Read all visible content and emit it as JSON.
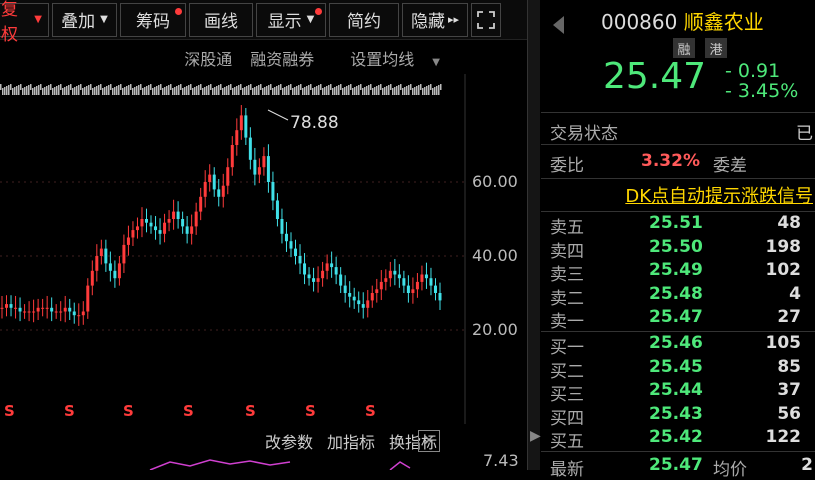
{
  "toolbar": {
    "items": [
      {
        "label": "复权",
        "active": true,
        "caret": true,
        "dot": false
      },
      {
        "label": "叠加",
        "caret": true,
        "dot": false
      },
      {
        "label": "筹码",
        "dot": true
      },
      {
        "label": "画线"
      },
      {
        "label": "显示",
        "caret": true,
        "dot": true
      },
      {
        "label": "简约"
      },
      {
        "label": "隐藏",
        "arrow": "▸▸"
      }
    ]
  },
  "subbar": {
    "items": [
      "深股通",
      "融资融券",
      "设置均线"
    ]
  },
  "chart": {
    "high_label": "78.88",
    "y_ticks": [
      "60.00",
      "40.00",
      "20.00"
    ],
    "bottom_tick": "7.43",
    "dividend_marker": "S"
  },
  "chart_data": {
    "type": "candlestick",
    "title": "",
    "annotations": [
      "78.88"
    ],
    "ylim": [
      12,
      88
    ],
    "y_ticks": [
      60,
      40,
      20
    ],
    "series": [
      {
        "values": [
          26,
          27,
          26,
          26,
          25,
          25,
          25,
          25,
          26,
          26,
          26,
          25,
          25,
          25,
          26,
          25,
          24,
          24,
          25,
          32,
          36,
          40,
          42,
          38,
          36,
          34,
          38,
          43,
          45,
          47,
          48,
          50,
          49,
          48,
          47,
          46,
          49,
          50,
          52,
          50,
          48,
          46,
          48,
          52,
          56,
          60,
          62,
          58,
          56,
          59,
          64,
          70,
          74,
          78,
          72,
          66,
          62,
          64,
          67,
          60,
          55,
          50,
          46,
          44,
          42,
          40,
          38,
          35,
          34,
          33,
          34,
          36,
          38,
          37,
          35,
          32,
          30,
          29,
          28,
          27,
          26,
          28,
          30,
          31,
          33,
          34,
          36,
          35,
          34,
          32,
          30,
          31,
          33,
          35,
          34,
          32,
          30,
          28
        ]
      }
    ]
  },
  "bottombar": {
    "items": [
      "改参数",
      "加指标",
      "换指标"
    ],
    "close": "✕"
  },
  "quote": {
    "code": "000860",
    "name": "顺鑫农业",
    "tags": [
      "融",
      "港"
    ],
    "price": "25.47",
    "change": "- 0.91",
    "change_pct": "- 3.45%"
  },
  "status": {
    "label": "交易状态",
    "value": "已"
  },
  "weibi": {
    "label": "委比",
    "value": "3.32%",
    "label2": "委差"
  },
  "dk_link": "DK点自动提示涨跌信号",
  "sell": [
    {
      "name": "卖五",
      "price": "25.51",
      "qty": "48"
    },
    {
      "name": "卖四",
      "price": "25.50",
      "qty": "198"
    },
    {
      "name": "卖三",
      "price": "25.49",
      "qty": "102"
    },
    {
      "name": "卖二",
      "price": "25.48",
      "qty": "4"
    },
    {
      "name": "卖一",
      "price": "25.47",
      "qty": "27"
    }
  ],
  "buy": [
    {
      "name": "买一",
      "price": "25.46",
      "qty": "105"
    },
    {
      "name": "买二",
      "price": "25.45",
      "qty": "85"
    },
    {
      "name": "买三",
      "price": "25.44",
      "qty": "37"
    },
    {
      "name": "买四",
      "price": "25.43",
      "qty": "56"
    },
    {
      "name": "买五",
      "price": "25.42",
      "qty": "122"
    }
  ],
  "last": {
    "label": "最新",
    "price": "25.47",
    "label2": "均价",
    "value2": "2"
  },
  "colors": {
    "up": "#ff3b3b",
    "down": "#4ee87a",
    "name": "#ffd700"
  }
}
